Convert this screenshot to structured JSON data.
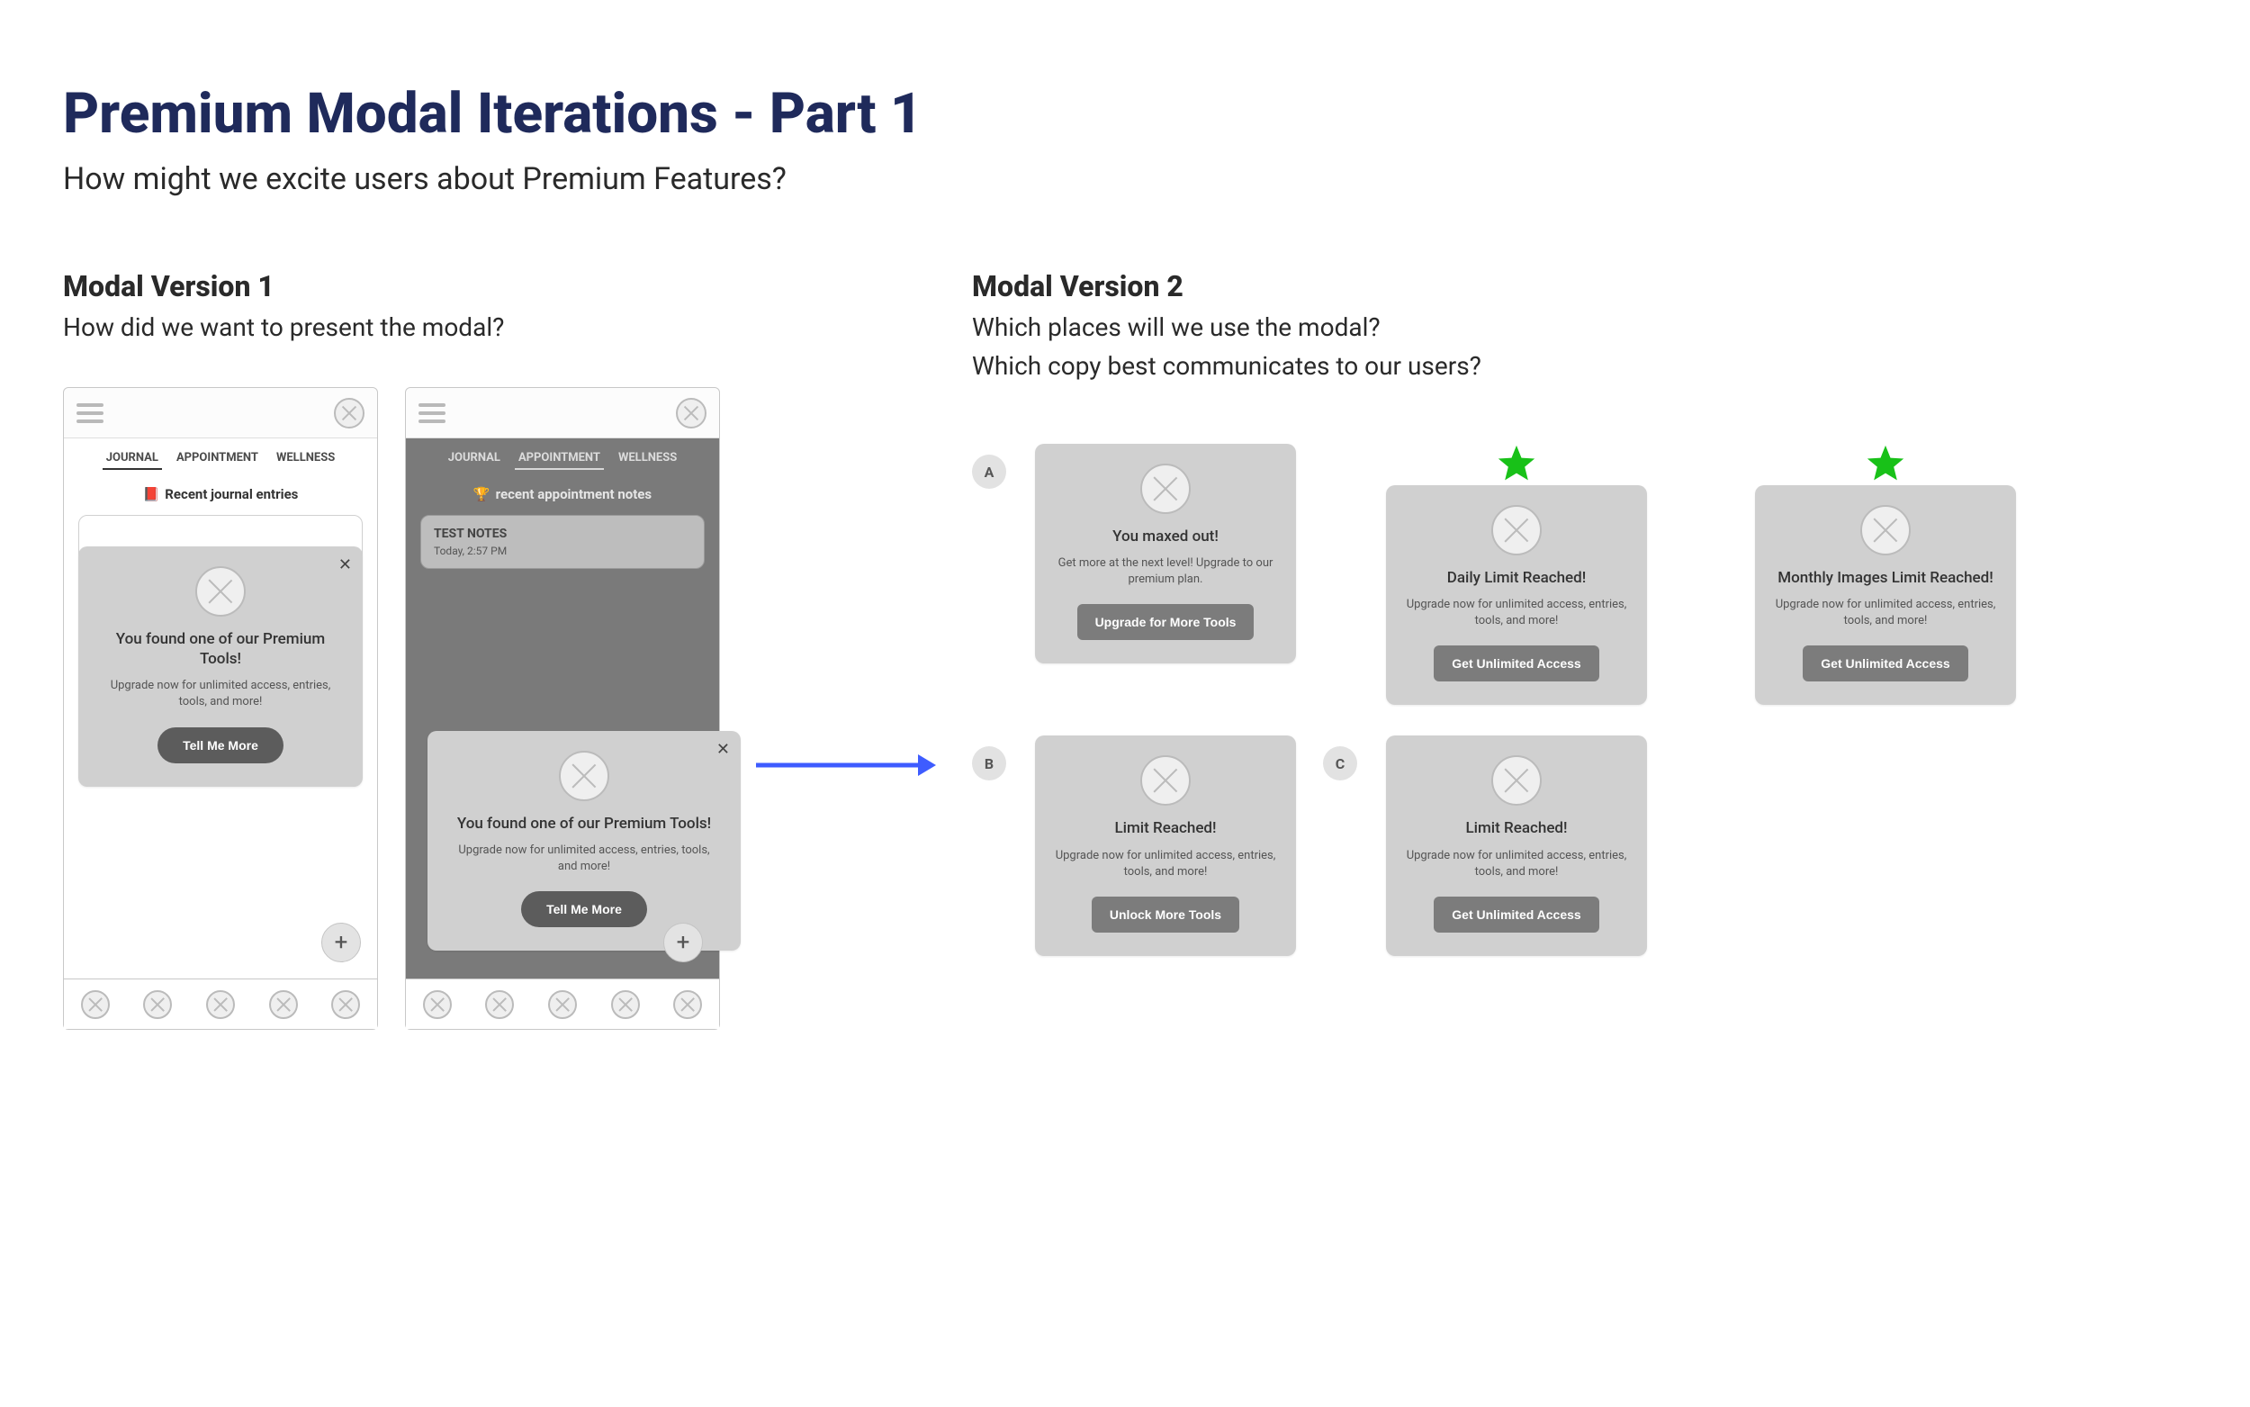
{
  "page": {
    "title": "Premium Modal Iterations - Part 1",
    "subtitle": "How might we excite users about Premium Features?"
  },
  "v1": {
    "heading": "Modal Version 1",
    "sub": "How did we want to present the modal?",
    "tabs": {
      "journal": "JOURNAL",
      "appointment": "APPOINTMENT",
      "wellness": "WELLNESS"
    },
    "phone1": {
      "entries_label": "Recent journal entries",
      "entries_emoji": "📕",
      "modal": {
        "title": "You found one of our Premium Tools!",
        "body": "Upgrade now for unlimited access, entries, tools, and more!",
        "button": "Tell Me More"
      }
    },
    "phone2": {
      "entries_label": "recent appointment notes",
      "entries_emoji": "🏆",
      "note": {
        "title": "TEST NOTES",
        "date": "Today, 2:57 PM"
      },
      "modal": {
        "title": "You found one of our Premium Tools!",
        "body": "Upgrade now for unlimited access, entries, tools, and more!",
        "button": "Tell Me More"
      }
    },
    "fab": "+"
  },
  "v2": {
    "heading": "Modal Version 2",
    "sub1": "Which places will we use the modal?",
    "sub2": "Which copy best communicates to our users?",
    "badges": {
      "a": "A",
      "b": "B",
      "c": "C"
    },
    "cards": {
      "a1": {
        "title": "You maxed out!",
        "body": "Get more at the next level! Upgrade to our premium plan.",
        "button": "Upgrade for More Tools",
        "starred": false
      },
      "a2": {
        "title": "Daily Limit Reached!",
        "body": "Upgrade now for unlimited access, entries, tools, and more!",
        "button": "Get Unlimited Access",
        "starred": true
      },
      "a3": {
        "title": "Monthly Images Limit Reached!",
        "body": "Upgrade now for unlimited access, entries, tools, and more!",
        "button": "Get Unlimited Access",
        "starred": true
      },
      "b1": {
        "title": "Limit Reached!",
        "body": "Upgrade now for unlimited access, entries, tools, and more!",
        "button": "Unlock More Tools",
        "starred": false
      },
      "c1": {
        "title": "Limit Reached!",
        "body": "Upgrade now for unlimited access, entries, tools, and more!",
        "button": "Get Unlimited Access",
        "starred": false
      }
    }
  }
}
